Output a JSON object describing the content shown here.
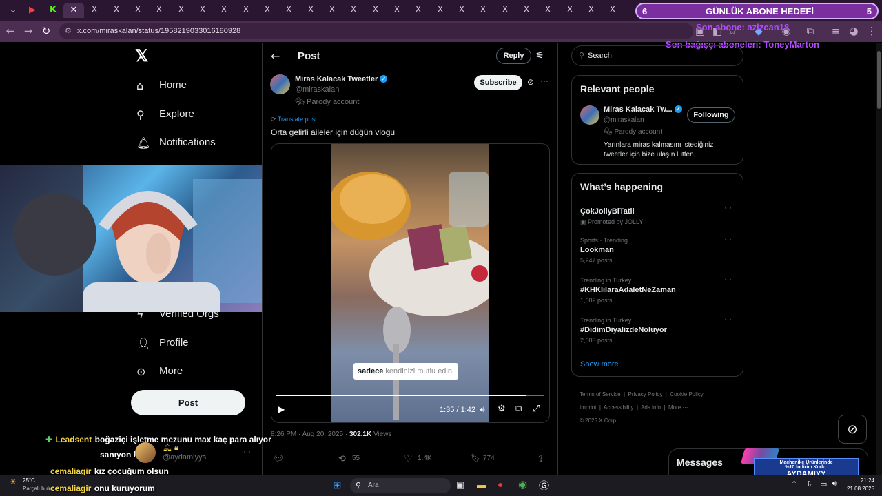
{
  "browser": {
    "url": "x.com/miraskalan/status/1958219033016180928",
    "tab_close": "✕",
    "tab_glyph": "X"
  },
  "overlay": {
    "goal_left": "6",
    "goal_title": "GÜNLÜK ABONE HEDEFİ",
    "goal_right": "5",
    "last_sub": "Son abone: azizcan18",
    "last_donor": "Son bağışçı aboneleri: ToneyMarton"
  },
  "nav": {
    "items": [
      {
        "label": "Home",
        "icon": "home-icon"
      },
      {
        "label": "Explore",
        "icon": "search-icon"
      },
      {
        "label": "Notifications",
        "icon": "bell-icon"
      },
      {
        "label": "Verified Orgs",
        "icon": "lightning-icon"
      },
      {
        "label": "Profile",
        "icon": "person-icon"
      },
      {
        "label": "More",
        "icon": "more-circle-icon"
      }
    ],
    "post_button": "Post"
  },
  "header": {
    "title": "Post",
    "reply_button": "Reply"
  },
  "tweet": {
    "name": "Miras Kalacak Tweetler",
    "handle": "@miraskalan",
    "badge": "Parody account",
    "subscribe_button": "Subscribe",
    "translate": "Translate post",
    "text": "Orta gelirli aileler için düğün vlogu",
    "caption_bold": "sadece",
    "caption_rest": "kendinizi mutlu edin.",
    "video_time": "1:35 / 1:42",
    "video_progress": 0.93,
    "timestamp": "8:26 PM · Aug 20, 2025 ·",
    "views_count": "302.1K",
    "views_label": "Views",
    "retweets": "55",
    "likes": "1.4K",
    "bookmarks": "774"
  },
  "search": {
    "placeholder": "Search"
  },
  "relevant": {
    "title": "Relevant people",
    "name": "Miras Kalacak Tw...",
    "handle": "@miraskalan",
    "badge": "Parody account",
    "follow_button": "Following",
    "bio": "Yarınlara miras kalmasını istediğiniz tweetler için bize ulaşın lütfen."
  },
  "happening": {
    "title": "What’s happening",
    "trends": [
      {
        "meta": "",
        "title": "ÇokJollyBiTatil",
        "count": "Promoted by JOLLY"
      },
      {
        "meta": "Sports · Trending",
        "title": "Lookman",
        "count": "5,247 posts"
      },
      {
        "meta": "Trending in Turkey",
        "title": "#KHKlılaraAdaletNeZaman",
        "count": "1,602 posts"
      },
      {
        "meta": "Trending in Turkey",
        "title": "#DidimDiyalizdeNoluyor",
        "count": "2,603 posts"
      }
    ],
    "show_more": "Show more"
  },
  "footer": {
    "links": [
      "Terms of Service",
      "Privacy Policy",
      "Cookie Policy",
      "Imprint",
      "Accessibility",
      "Ads info",
      "More ···"
    ],
    "copyright": "© 2025 X Corp."
  },
  "messages": {
    "title": "Messages"
  },
  "promo": {
    "line1": "Machenike Ürünlerinde",
    "line2": "%10 İndirim Kodu:",
    "code": "AYDAMIYY"
  },
  "chat": [
    {
      "name": "Leadsent",
      "msg": "boğaziçi işletme mezunu max kaç para alıyor"
    },
    {
      "name": "",
      "msg": "sanıyon ki"
    },
    {
      "name": "cemaliagir",
      "msg": "kız çocuğum olsun"
    },
    {
      "name": "cemaliagir",
      "msg": "onu kuruyorum"
    }
  ],
  "reply_handle": "@aydamiyys",
  "taskbar": {
    "weather_temp": "25°C",
    "weather_desc": "Parçalı bulut",
    "search_label": "Ara",
    "time": "21:24",
    "date": "21.08.2025"
  }
}
